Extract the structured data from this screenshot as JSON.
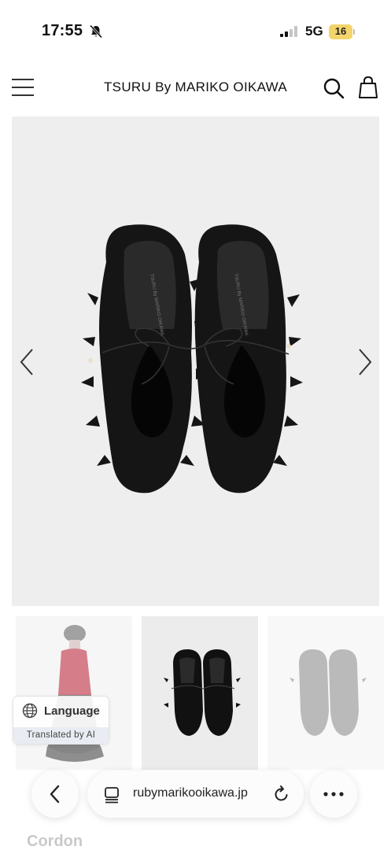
{
  "status_bar": {
    "time": "17:55",
    "network": "5G",
    "battery": "16"
  },
  "header": {
    "brand": "TSURU By MARIKO OIKAWA"
  },
  "language_widget": {
    "label": "Language",
    "sub_label": "Translated by AI"
  },
  "browser": {
    "url": "rubymarikooikawa.jp"
  },
  "peek_text": "Cordon",
  "colors": {
    "image_background": "#eeeeef",
    "shoe": "#111111",
    "battery": "#f3d46b"
  }
}
